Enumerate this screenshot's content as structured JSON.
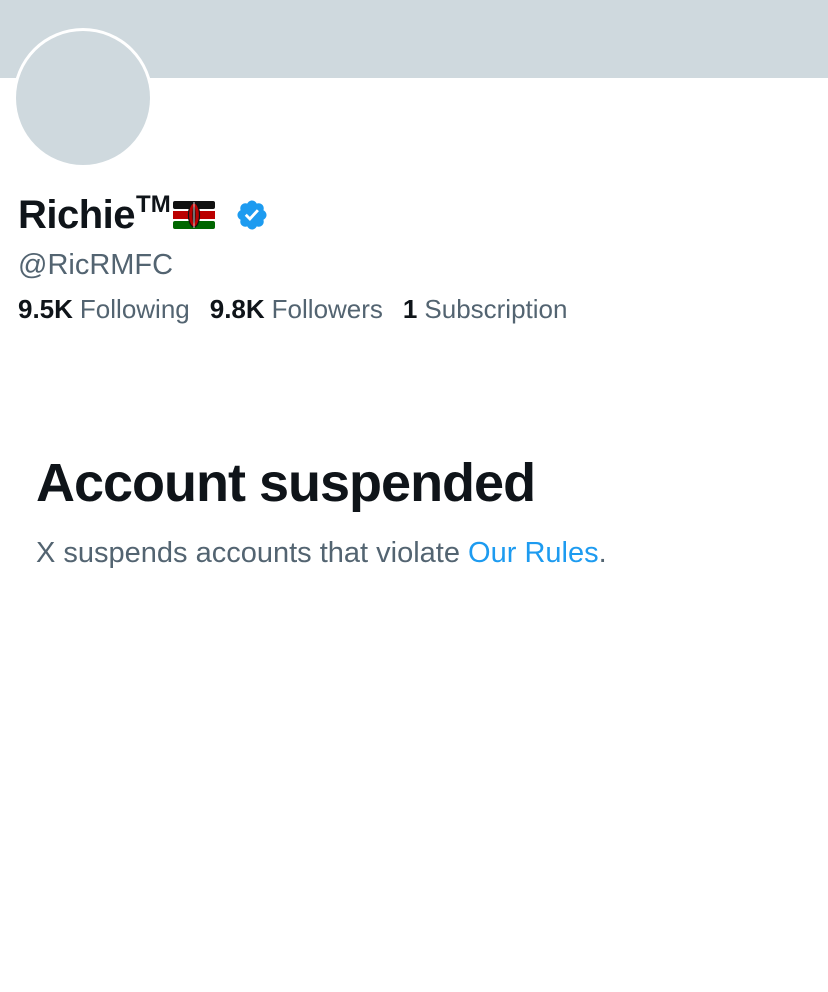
{
  "profile": {
    "display_name": "Richie",
    "trademark": "TM",
    "flag_icon": "kenya-flag-icon",
    "verified_icon": "verified-badge-icon",
    "handle": "@RicRMFC"
  },
  "stats": [
    {
      "count": "9.5K",
      "label": "Following"
    },
    {
      "count": "9.8K",
      "label": "Followers"
    },
    {
      "count": "1",
      "label": "Subscription"
    }
  ],
  "suspension": {
    "title": "Account suspended",
    "body_prefix": "X suspends accounts that violate ",
    "link_text": "Our Rules",
    "body_suffix": "."
  },
  "colors": {
    "banner": "#cfd9de",
    "avatar_placeholder": "#cfd9de",
    "text_primary": "#0f1419",
    "text_secondary": "#536471",
    "link": "#1d9bf0",
    "verified": "#1d9bf0"
  }
}
